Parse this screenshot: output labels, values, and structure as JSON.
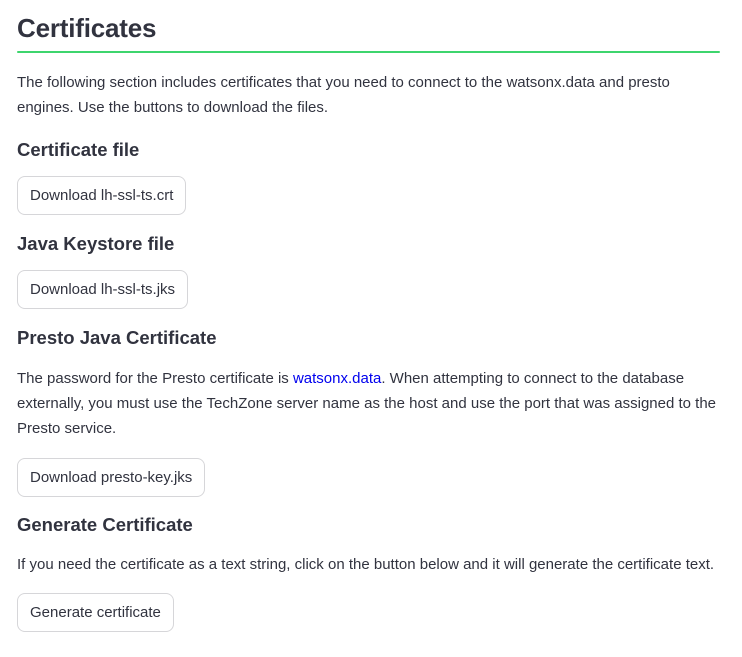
{
  "page": {
    "title": "Certificates",
    "accent_color": "#3dd56d",
    "link_color": "#0000ee",
    "intro": "The following section includes certificates that you need to connect to the watsonx.data and presto engines. Use the buttons to download the files."
  },
  "sections": {
    "certificate_file": {
      "heading": "Certificate file",
      "button_label": "Download lh-ssl-ts.crt"
    },
    "java_keystore": {
      "heading": "Java Keystore file",
      "button_label": "Download lh-ssl-ts.jks"
    },
    "presto_java_cert": {
      "heading": "Presto Java Certificate",
      "text_before_link": "The password for the Presto certificate is ",
      "link_text": "watsonx.data",
      "text_after_link": ". When attempting to connect to the database externally, you must use the TechZone server name as the host and use the port that was assigned to the Presto service.",
      "button_label": "Download presto-key.jks"
    },
    "generate_cert": {
      "heading": "Generate Certificate",
      "text": "If you need the certificate as a text string, click on the button below and it will generate the certificate text.",
      "button_label": "Generate certificate"
    }
  }
}
